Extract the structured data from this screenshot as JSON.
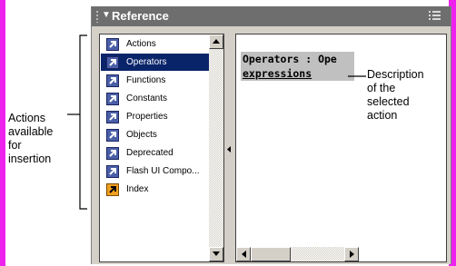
{
  "panel": {
    "title": "Reference",
    "collapse_arrow": "▼"
  },
  "list": {
    "items": [
      {
        "label": "Actions",
        "icon": "book-icon",
        "selected": false
      },
      {
        "label": "Operators",
        "icon": "book-icon",
        "selected": true
      },
      {
        "label": "Functions",
        "icon": "book-icon",
        "selected": false
      },
      {
        "label": "Constants",
        "icon": "book-icon",
        "selected": false
      },
      {
        "label": "Properties",
        "icon": "book-icon",
        "selected": false
      },
      {
        "label": "Objects",
        "icon": "book-icon",
        "selected": false
      },
      {
        "label": "Deprecated",
        "icon": "book-icon",
        "selected": false
      },
      {
        "label": "Flash UI Compo...",
        "icon": "book-icon",
        "selected": false
      },
      {
        "label": "Index",
        "icon": "index-book-icon",
        "selected": false
      }
    ]
  },
  "description": {
    "title_line1": "Operators : Ope",
    "title_line2": "expressions"
  },
  "annotations": {
    "left": [
      "Actions",
      "available",
      "for",
      "insertion"
    ],
    "right": [
      "Description",
      "of the",
      "selected",
      "action"
    ]
  },
  "colors": {
    "background_border": "#ee22ee",
    "titlebar": "#6e6e6e",
    "selection": "#0a246a",
    "panel": "#d4d0c8"
  }
}
